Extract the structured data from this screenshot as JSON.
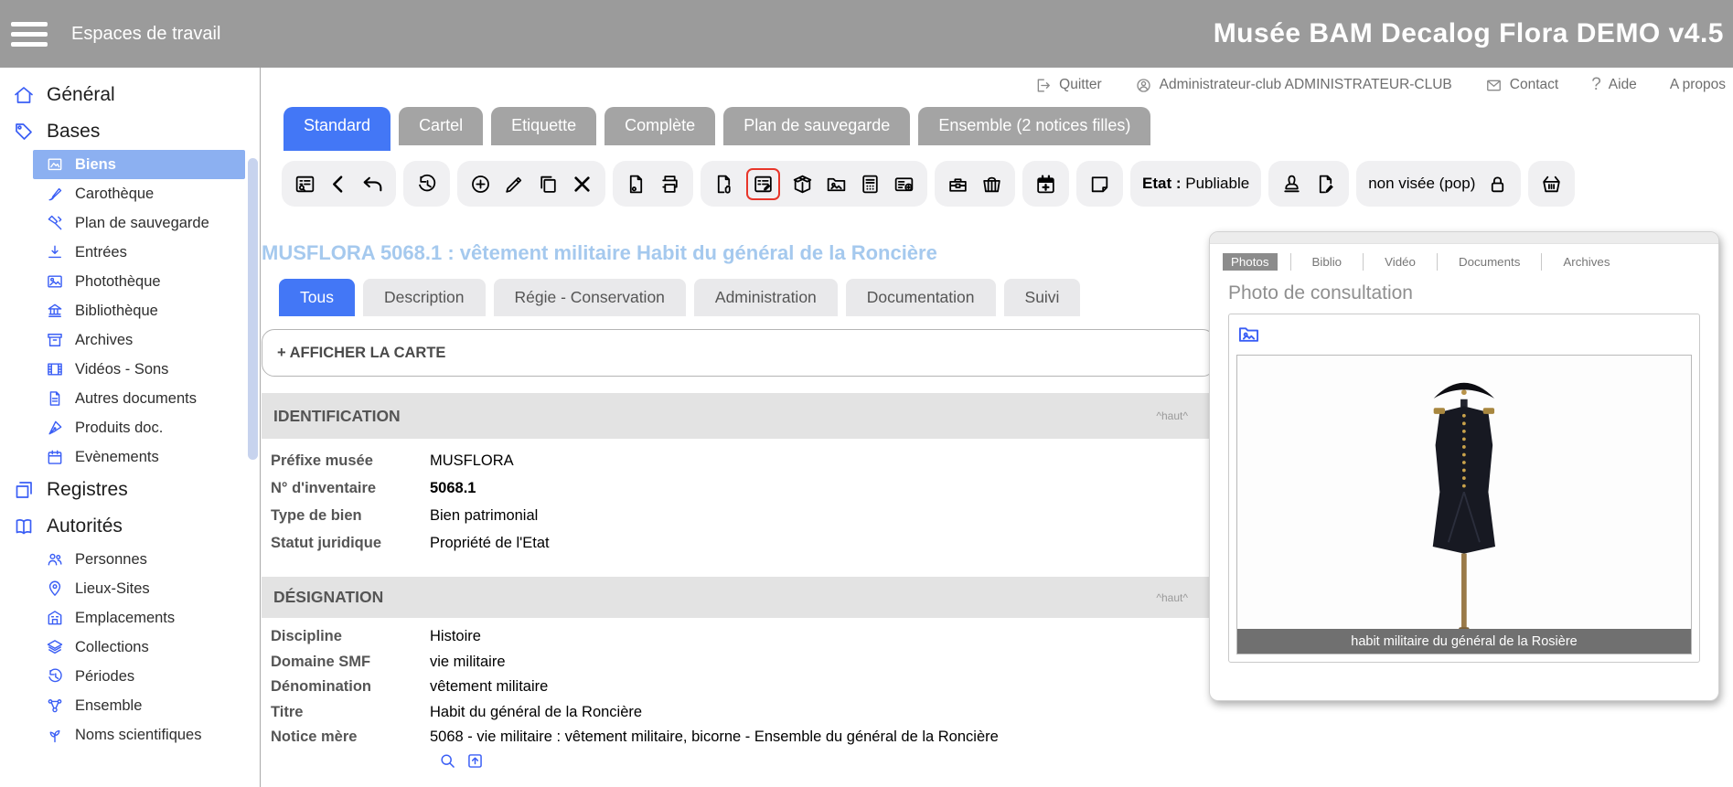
{
  "header": {
    "workspace_label": "Espaces de travail",
    "app_title": "Musée BAM Decalog Flora DEMO v4.5"
  },
  "user_bar": {
    "quit": "Quitter",
    "user_name": "Administrateur-club ADMINISTRATEUR-CLUB",
    "contact": "Contact",
    "help": "Aide",
    "help_glyph": "?",
    "about": "A propos"
  },
  "view_tabs": [
    {
      "label": "Standard",
      "active": true
    },
    {
      "label": "Cartel",
      "active": false
    },
    {
      "label": "Etiquette",
      "active": false
    },
    {
      "label": "Complète",
      "active": false
    },
    {
      "label": "Plan de sauvegarde",
      "active": false
    },
    {
      "label": "Ensemble (2 notices filles)",
      "active": false
    }
  ],
  "toolbar": {
    "etat_label": "Etat :",
    "etat_value": "Publiable",
    "visa_label": "non visée (pop)"
  },
  "record": {
    "title": "MUSFLORA 5068.1 : vêtement militaire Habit du général de la Roncière"
  },
  "record_tabs": [
    {
      "label": "Tous",
      "active": true
    },
    {
      "label": "Description",
      "active": false
    },
    {
      "label": "Régie - Conservation",
      "active": false
    },
    {
      "label": "Administration",
      "active": false
    },
    {
      "label": "Documentation",
      "active": false
    },
    {
      "label": "Suivi",
      "active": false
    }
  ],
  "map_toggle": {
    "label": "+ AFFICHER LA CARTE"
  },
  "sections": [
    {
      "title": "IDENTIFICATION",
      "top_link": "^haut^",
      "rows": [
        {
          "label": "Préfixe musée",
          "value": "MUSFLORA"
        },
        {
          "label": "N° d'inventaire",
          "value": "5068.1"
        },
        {
          "label": "Type de bien",
          "value": "Bien patrimonial"
        },
        {
          "label": "Statut juridique",
          "value": "Propriété de l'Etat"
        }
      ]
    },
    {
      "title": "DÉSIGNATION",
      "top_link": "^haut^",
      "rows": [
        {
          "label": "Discipline",
          "value": "Histoire"
        },
        {
          "label": "Domaine SMF",
          "value": "vie militaire"
        },
        {
          "label": "Dénomination",
          "value": "vêtement militaire"
        },
        {
          "label": "Titre",
          "value": "Habit du général de la Roncière"
        },
        {
          "label": "Notice mère",
          "value": "5068 - vie militaire : vêtement militaire, bicorne - Ensemble du général de la Roncière"
        }
      ]
    }
  ],
  "sidebar": {
    "items": [
      {
        "label": "Général",
        "type": "section"
      },
      {
        "label": "Bases",
        "type": "section"
      },
      {
        "label": "Biens",
        "type": "item",
        "selected": true
      },
      {
        "label": "Carothèque",
        "type": "item"
      },
      {
        "label": "Plan de sauvegarde",
        "type": "item"
      },
      {
        "label": "Entrées",
        "type": "item"
      },
      {
        "label": "Photothèque",
        "type": "item"
      },
      {
        "label": "Bibliothèque",
        "type": "item"
      },
      {
        "label": "Archives",
        "type": "item"
      },
      {
        "label": "Vidéos - Sons",
        "type": "item"
      },
      {
        "label": "Autres documents",
        "type": "item"
      },
      {
        "label": "Produits doc.",
        "type": "item"
      },
      {
        "label": "Evènements",
        "type": "item"
      },
      {
        "label": "Registres",
        "type": "section"
      },
      {
        "label": "Autorités",
        "type": "section"
      },
      {
        "label": "Personnes",
        "type": "item"
      },
      {
        "label": "Lieux-Sites",
        "type": "item"
      },
      {
        "label": "Emplacements",
        "type": "item"
      },
      {
        "label": "Collections",
        "type": "item"
      },
      {
        "label": "Périodes",
        "type": "item"
      },
      {
        "label": "Ensemble",
        "type": "item"
      },
      {
        "label": "Noms scientifiques",
        "type": "item"
      }
    ]
  },
  "right_panel": {
    "tabs": [
      {
        "label": "Photos",
        "active": true
      },
      {
        "label": "Biblio",
        "active": false
      },
      {
        "label": "Vidéo",
        "active": false
      },
      {
        "label": "Documents",
        "active": false
      },
      {
        "label": "Archives",
        "active": false
      }
    ],
    "heading": "Photo de consultation",
    "photo_caption": "habit militaire du général de la Rosière"
  },
  "colors": {
    "accent_blue": "#4377f6",
    "icon_blue": "#3a5ef5",
    "record_title_blue": "#a5c9ee",
    "selected_nav_bg": "#8cb0f1",
    "header_gray": "#9b9b9b",
    "highlight_red": "#e8362a",
    "section_bar_gray": "#e3e3e3",
    "caption_gray": "#707070"
  }
}
